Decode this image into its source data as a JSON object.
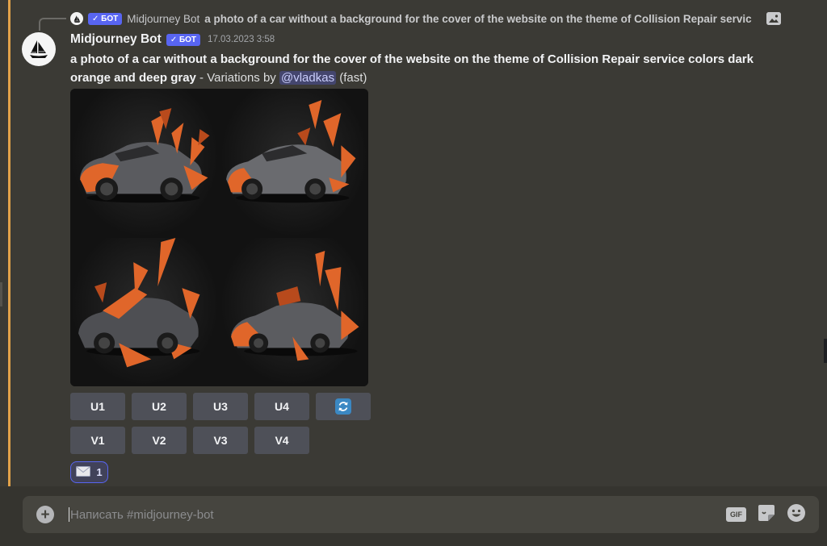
{
  "reply": {
    "author": "Midjourney Bot",
    "badge": "✓ БОТ",
    "snippet": "a photo of a car without a background for the cover of the website on the theme of Collision Repair servic"
  },
  "message": {
    "username": "Midjourney Bot",
    "badge": "✓ БОТ",
    "timestamp": "17.03.2023 3:58",
    "prompt": "a photo of a car without a background for the cover of the website on the theme of Collision Repair service colors dark orange and deep gray",
    "suffix": " - Variations by ",
    "mention": "@vladkas",
    "mode": " (fast)"
  },
  "buttons": {
    "upscale": [
      "U1",
      "U2",
      "U3",
      "U4"
    ],
    "variations": [
      "V1",
      "V2",
      "V3",
      "V4"
    ]
  },
  "reaction": {
    "emoji": "envelope-icon",
    "count": "1"
  },
  "composer": {
    "placeholder": "Написать #midjourney-bot",
    "gif_label": "GIF"
  },
  "colors": {
    "accent": "#5865f2",
    "highlight": "#e2a24a",
    "car_orange": "#e0662a",
    "car_gray": "#55565a"
  }
}
